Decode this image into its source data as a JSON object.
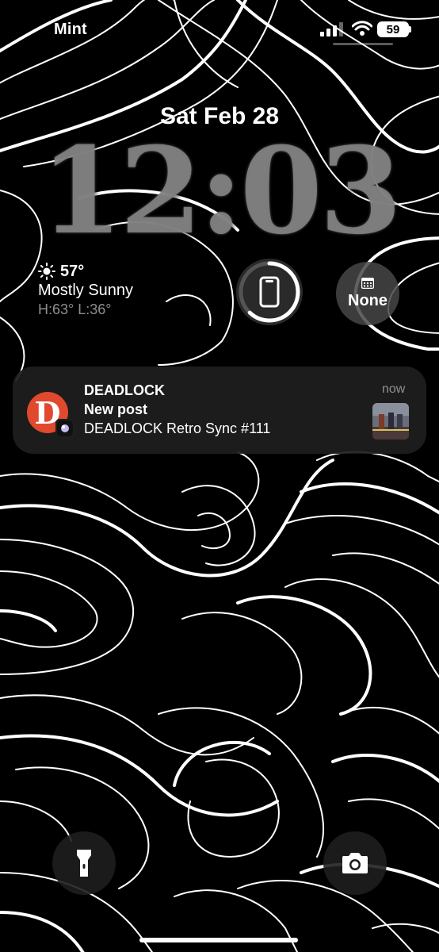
{
  "status_bar": {
    "carrier": "Mint",
    "battery_percent": "59"
  },
  "lock_screen": {
    "date": "Sat Feb 28",
    "time": "12:03"
  },
  "weather": {
    "icon": "sun-icon",
    "temperature": "57°",
    "condition": "Mostly Sunny",
    "high_low": "H:63° L:36°"
  },
  "widgets": {
    "device_battery_icon": "phone-icon",
    "device_battery_level": 0.62,
    "calendar_icon": "calendar-icon",
    "calendar_label": "None"
  },
  "notification": {
    "app": "DEADLOCK",
    "title": "New post",
    "body": "DEADLOCK Retro Sync #111",
    "time": "now",
    "app_icon_letter": "D"
  },
  "bottom": {
    "left_button_icon": "flashlight-icon",
    "right_button_icon": "camera-icon"
  },
  "colors": {
    "background": "#000000",
    "contour_lines": "#ffffff",
    "app_icon": "#e0492e",
    "notification_bg": "#1e1e1e"
  }
}
